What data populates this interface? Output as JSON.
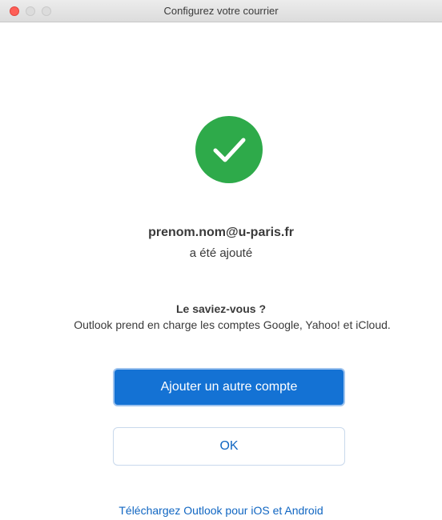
{
  "window": {
    "title": "Configurez votre courrier"
  },
  "status": {
    "icon": "checkmark-icon",
    "color": "#2eaa4a",
    "email": "prenom.nom@u-paris.fr",
    "message": "a été ajouté"
  },
  "tip": {
    "title": "Le saviez-vous ?",
    "body": "Outlook prend en charge les comptes Google, Yahoo! et iCloud."
  },
  "buttons": {
    "add_account": "Ajouter un autre compte",
    "ok": "OK"
  },
  "footer": {
    "download_link": "Téléchargez Outlook pour iOS et Android"
  },
  "colors": {
    "primary": "#1472d4",
    "link": "#1066c2",
    "close": "#fe5f57"
  }
}
